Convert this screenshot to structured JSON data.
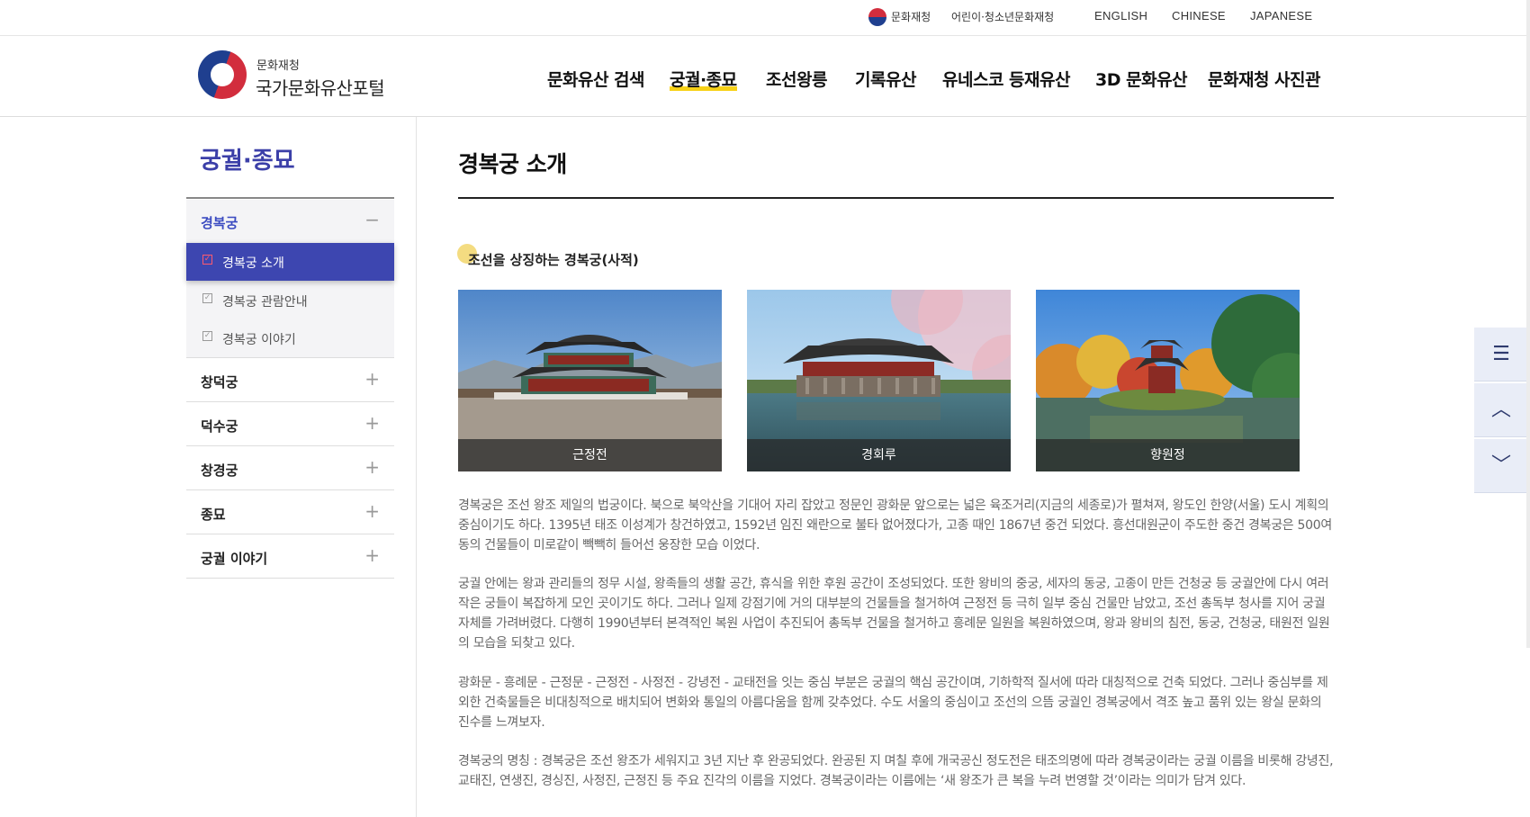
{
  "topbar": {
    "org": "문화재청",
    "kids": "어린이·청소년문화재청",
    "english": "ENGLISH",
    "chinese": "CHINESE",
    "japanese": "JAPANESE"
  },
  "logo": {
    "sub": "문화재청",
    "main": "국가문화유산포털"
  },
  "gnb": [
    "문화유산 검색",
    "궁궐·종묘",
    "조선왕릉",
    "기록유산",
    "유네스코 등재유산",
    "3D 문화유산",
    "문화재청 사진관"
  ],
  "gnb_active_index": 1,
  "sidebar": {
    "title": "궁궐·종묘",
    "sections": [
      {
        "label": "경복궁",
        "toggle": "−",
        "open": true
      },
      {
        "label": "창덕궁",
        "toggle": "+"
      },
      {
        "label": "덕수궁",
        "toggle": "+"
      },
      {
        "label": "창경궁",
        "toggle": "+"
      },
      {
        "label": "종묘",
        "toggle": "+"
      },
      {
        "label": "궁궐 이야기",
        "toggle": "+"
      }
    ],
    "sub_items": [
      {
        "label": "경복궁 소개",
        "active": true
      },
      {
        "label": "경복궁 관람안내"
      },
      {
        "label": "경복궁 이야기"
      }
    ]
  },
  "content": {
    "title": "경복궁 소개",
    "section_title": "조선을 상징하는 경복궁(사적)",
    "photos": [
      {
        "caption": "근정전",
        "icon": "palace-hall-photo"
      },
      {
        "caption": "경회루",
        "icon": "pavilion-pond-photo"
      },
      {
        "caption": "향원정",
        "icon": "hexagonal-pavilion-photo"
      }
    ],
    "paragraphs": [
      "경복궁은 조선 왕조 제일의 법궁이다. 북으로 북악산을 기대어 자리 잡았고 정문인 광화문 앞으로는 넓은 육조거리(지금의 세종로)가 펼쳐져, 왕도인 한양(서울) 도시 계획의 중심이기도 하다. 1395년 태조 이성계가 창건하였고, 1592년 임진 왜란으로 불타 없어졌다가, 고종 때인 1867년 중건 되었다. 흥선대원군이 주도한 중건 경복궁은 500여 동의 건물들이 미로같이 빽빽히 들어선 웅장한 모습 이었다.",
      "궁궐 안에는 왕과 관리들의 정무 시설, 왕족들의 생활 공간, 휴식을 위한 후원 공간이 조성되었다. 또한 왕비의 중궁, 세자의 동궁, 고종이 만든 건청궁 등 궁궐안에 다시 여러 작은 궁들이 복잡하게 모인 곳이기도 하다. 그러나 일제 강점기에 거의 대부분의 건물들을 철거하여 근정전 등 극히 일부 중심 건물만 남았고, 조선 총독부 청사를 지어 궁궐 자체를 가려버렸다. 다행히 1990년부터 본격적인 복원 사업이 추진되어 총독부 건물을 철거하고 흥례문 일원을 복원하였으며, 왕과 왕비의 침전, 동궁, 건청궁, 태원전 일원의 모습을 되찾고 있다.",
      "광화문 - 흥례문 - 근정문 - 근정전 - 사정전 - 강녕전 - 교태전을 잇는 중심 부분은 궁궐의 핵심 공간이며, 기하학적 질서에 따라 대칭적으로 건축 되었다. 그러나 중심부를 제외한 건축물들은 비대칭적으로 배치되어 변화와 통일의 아름다움을 함께 갖추었다. 수도 서울의 중심이고 조선의 으뜸 궁궐인 경복궁에서 격조 높고 품위 있는 왕실 문화의 진수를 느껴보자.",
      "경복궁의 명칭 : 경복궁은 조선 왕조가 세워지고 3년 지난 후 완공되었다. 완공된 지 며칠 후에 개국공신 정도전은 태조의명에 따라 경복궁이라는 궁궐 이름을 비롯해 강녕진, 교태진, 연생진, 경싱진, 사정진, 근정진 등 주요 진각의 이름을 지었다. 경복궁이라는 이름에는 ‘새 왕조가 큰 복을 누려 번영할 것’이라는 의미가 담겨 있다."
    ]
  },
  "floating_buttons": [
    {
      "name": "menu",
      "icon": "hamburger-icon",
      "glyph": "☰"
    },
    {
      "name": "scroll-up",
      "icon": "chevron-up-icon",
      "glyph": "︿"
    },
    {
      "name": "scroll-down",
      "icon": "chevron-down-icon",
      "glyph": "﹀"
    }
  ],
  "colors": {
    "accent_purple": "#3b3fa8",
    "active_sub_bg": "#3d46b0",
    "gnb_underline": "#f7d117",
    "fab_bg": "#e9edf7"
  }
}
